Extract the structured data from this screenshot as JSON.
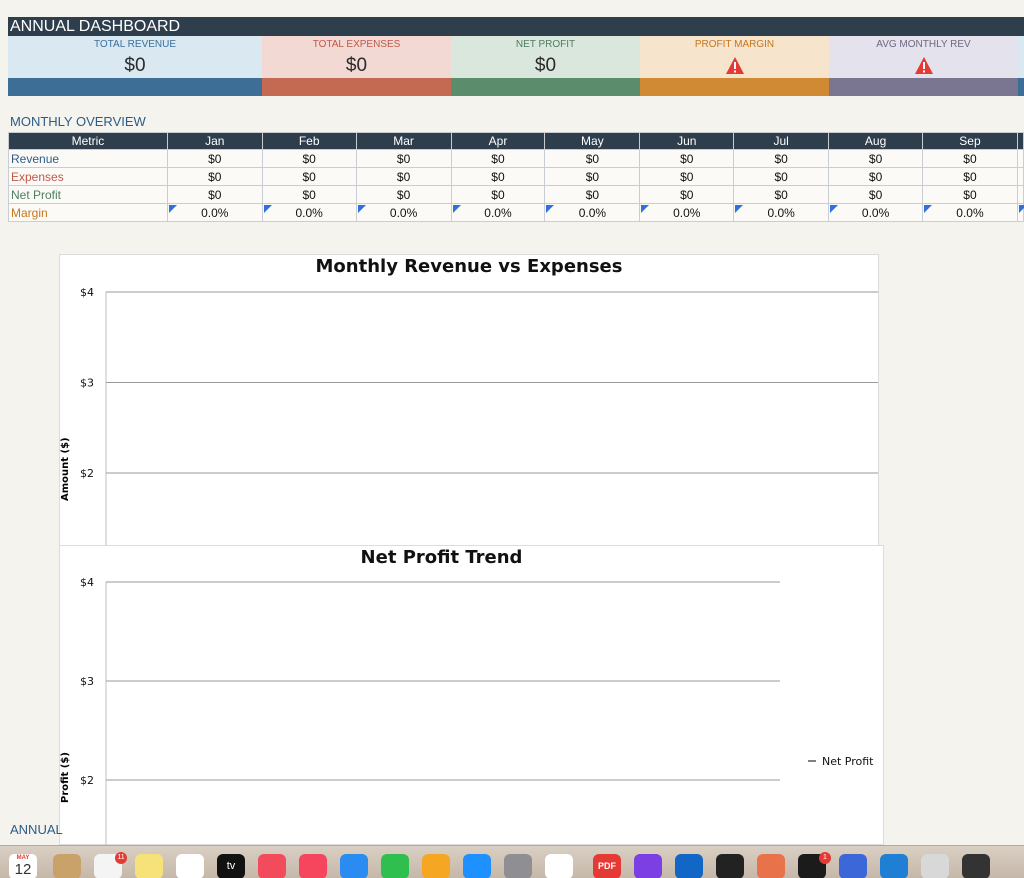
{
  "dashboard": {
    "title": "ANNUAL DASHBOARD",
    "sheet_tab": "ANNUAL"
  },
  "kpis": [
    {
      "label": "TOTAL REVENUE",
      "value": "$0",
      "label_color": "#3a6f9c",
      "bg": "#d9e8f1",
      "bar": "#3d6f96"
    },
    {
      "label": "TOTAL EXPENSES",
      "value": "$0",
      "label_color": "#c0594a",
      "bg": "#f3d9d3",
      "bar": "#c56a52"
    },
    {
      "label": "NET PROFIT",
      "value": "$0",
      "label_color": "#4f7d62",
      "bg": "#d9e7dc",
      "bar": "#5b8c6b"
    },
    {
      "label": "PROFIT MARGIN",
      "value": "",
      "label_color": "#c4781f",
      "bg": "#f6e4cc",
      "bar": "#d08a34",
      "icon": "warning-icon"
    },
    {
      "label": "AVG MONTHLY REV",
      "value": "",
      "label_color": "#6c6882",
      "bg": "#e4e2ec",
      "bar": "#7a7590",
      "icon": "warning-icon"
    }
  ],
  "overview": {
    "title": "MONTHLY OVERVIEW",
    "columns": [
      "Metric",
      "Jan",
      "Feb",
      "Mar",
      "Apr",
      "May",
      "Jun",
      "Jul",
      "Aug",
      "Sep"
    ],
    "rows": [
      {
        "label": "Revenue",
        "color": "#2e5b86",
        "values": [
          "$0",
          "$0",
          "$0",
          "$0",
          "$0",
          "$0",
          "$0",
          "$0",
          "$0"
        ]
      },
      {
        "label": "Expenses",
        "color": "#c0594a",
        "values": [
          "$0",
          "$0",
          "$0",
          "$0",
          "$0",
          "$0",
          "$0",
          "$0",
          "$0"
        ]
      },
      {
        "label": "Net Profit",
        "color": "#4f7d62",
        "values": [
          "$0",
          "$0",
          "$0",
          "$0",
          "$0",
          "$0",
          "$0",
          "$0",
          "$0"
        ]
      },
      {
        "label": "Margin",
        "color": "#c4781f",
        "values": [
          "0.0%",
          "0.0%",
          "0.0%",
          "0.0%",
          "0.0%",
          "0.0%",
          "0.0%",
          "0.0%",
          "0.0%"
        ],
        "flagged": true
      }
    ]
  },
  "chart_data": [
    {
      "type": "bar",
      "title": "Monthly Revenue vs Expenses",
      "ylabel": "Amount ($)",
      "xlabel": "",
      "yticks": [
        "$4",
        "$3",
        "$2"
      ],
      "ylim": [
        2,
        4
      ],
      "grid": true
    },
    {
      "type": "line",
      "title": "Net Profit Trend",
      "ylabel": "Profit ($)",
      "xlabel": "",
      "yticks": [
        "$4",
        "$3",
        "$2"
      ],
      "ylim": [
        2,
        4
      ],
      "grid": true,
      "legend": "right",
      "series": [
        {
          "name": "Net Profit",
          "values": []
        }
      ]
    }
  ],
  "dock": {
    "calendar_month": "MAY",
    "calendar_day": "12",
    "reminders_badge": "11",
    "terminal_badge": "1",
    "tv_label": "tv",
    "pdf_label": "PDF",
    "apps": [
      {
        "icon": "contacts-icon",
        "color": "#c9a26a"
      },
      {
        "icon": "reminders-icon",
        "color": "#f4f4f4"
      },
      {
        "icon": "notes-icon",
        "color": "#f7e27a"
      },
      {
        "icon": "freeform-icon",
        "color": "#ffffff"
      },
      {
        "icon": "apple-tv-icon",
        "color": "#111111"
      },
      {
        "icon": "news-icon",
        "color": "#f24b5b"
      },
      {
        "icon": "music-icon",
        "color": "#f6465e"
      },
      {
        "icon": "keynote-icon",
        "color": "#2a8cf0"
      },
      {
        "icon": "numbers-icon",
        "color": "#2fbf4f"
      },
      {
        "icon": "pages-icon",
        "color": "#f5a623"
      },
      {
        "icon": "app-store-icon",
        "color": "#1e90ff"
      },
      {
        "icon": "system-settings-icon",
        "color": "#8e8e93"
      },
      {
        "icon": "chrome-icon",
        "color": "#ffffff"
      },
      {
        "icon": "pdf-icon",
        "color": "#e53935"
      },
      {
        "icon": "shortcuts-icon",
        "color": "#7b3fe4"
      },
      {
        "icon": "outlook-icon",
        "color": "#1266c6"
      },
      {
        "icon": "roblox-icon",
        "color": "#222222"
      },
      {
        "icon": "claude-icon",
        "color": "#e8734a"
      },
      {
        "icon": "terminal-icon",
        "color": "#1b1b1b"
      },
      {
        "icon": "pencil-app-icon",
        "color": "#3b67d8"
      },
      {
        "icon": "vscode-icon",
        "color": "#1f7fd4"
      },
      {
        "icon": "printer-icon",
        "color": "#d8d8d8"
      },
      {
        "icon": "screenshot-thumbnail-icon",
        "color": "#333333"
      }
    ]
  }
}
